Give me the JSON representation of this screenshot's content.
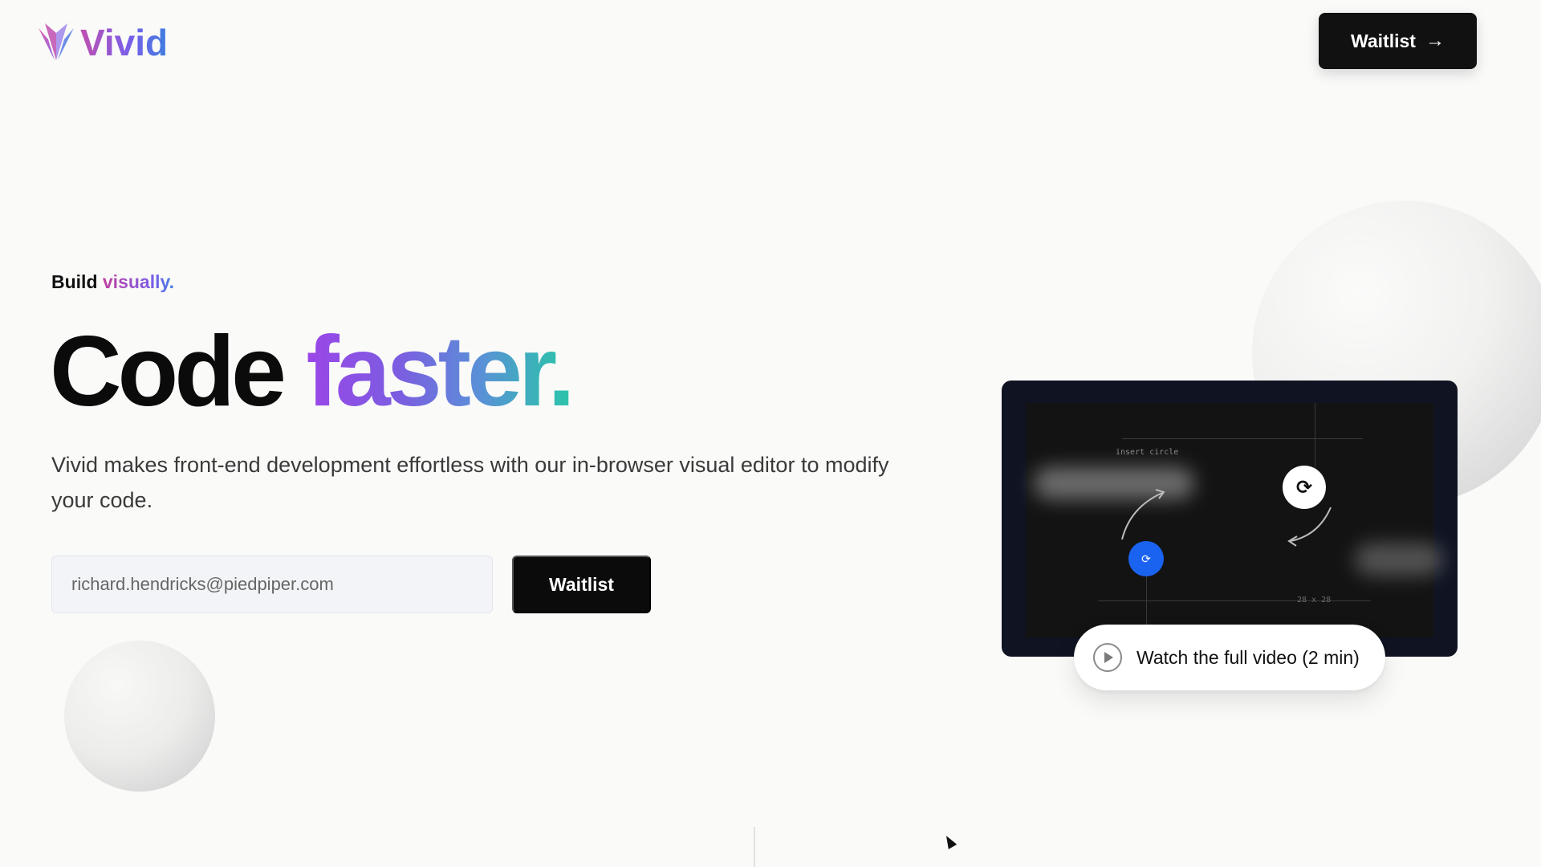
{
  "header": {
    "brand_name": "Vivid",
    "waitlist_label": "Waitlist",
    "waitlist_arrow": "→"
  },
  "hero": {
    "eyebrow_plain": "Build",
    "eyebrow_accent": "visually.",
    "headline_plain": "Code",
    "headline_accent": "faster.",
    "description": "Vivid makes front-end development effortless with our in-browser visual editor to modify your code.",
    "email_placeholder": "richard.hendricks@piedpiper.com",
    "waitlist_label": "Waitlist"
  },
  "video": {
    "screen_label": "insert circle",
    "size_label": "28 x 28",
    "watch_label": "Watch the full video (2 min)"
  },
  "colors": {
    "brand_gradient": [
      "#c04fb0",
      "#7a5ee8",
      "#3f7ee0"
    ],
    "headline_gradient": [
      "#9b46e8",
      "#5b8fd8",
      "#2ec4ab"
    ],
    "button_bg": "#0b0b0b",
    "video_frame": "#0f1322",
    "accent_blue": "#1a63f0"
  },
  "icons": {
    "logo": "vivid-logo-icon",
    "play": "play-icon",
    "arrow": "arrow-right-icon",
    "refresh": "refresh-icon"
  }
}
